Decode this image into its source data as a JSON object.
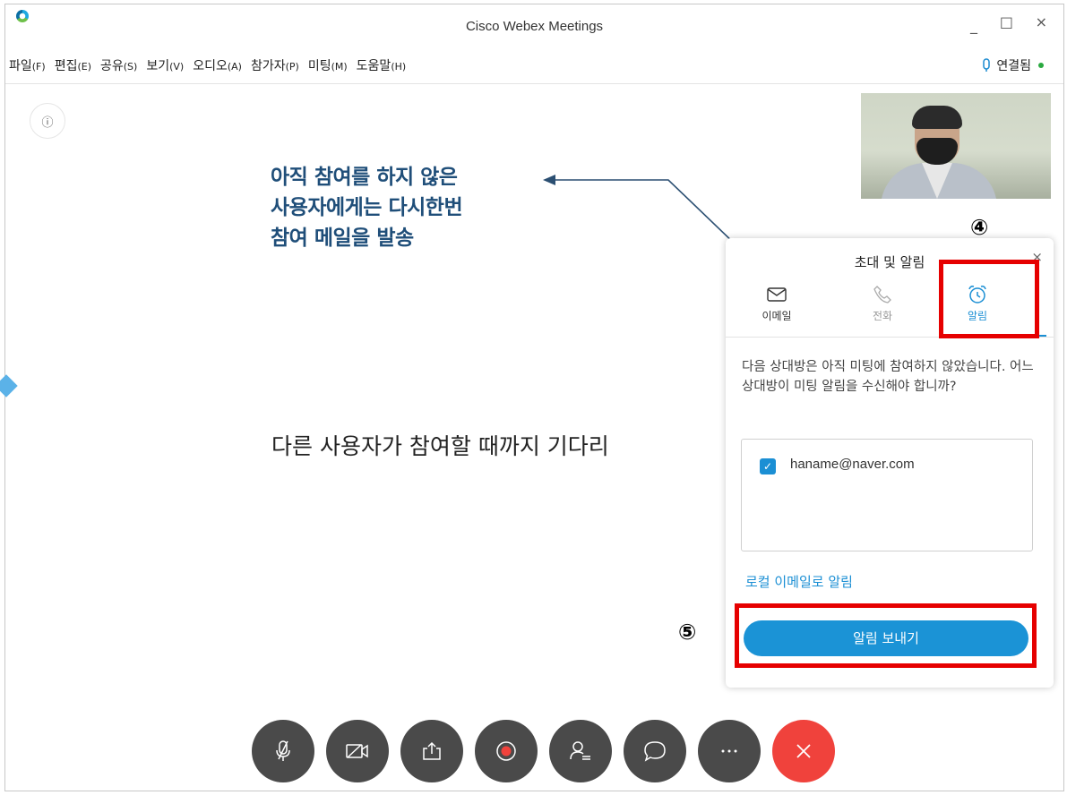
{
  "window": {
    "title": "Cisco Webex Meetings"
  },
  "window_controls": {
    "minimize": "_",
    "maximize": "□",
    "close": "×"
  },
  "menu": [
    {
      "label": "파일",
      "accel": "(F)"
    },
    {
      "label": "편집",
      "accel": "(E)"
    },
    {
      "label": "공유",
      "accel": "(S)"
    },
    {
      "label": "보기",
      "accel": "(V)"
    },
    {
      "label": "오디오",
      "accel": "(A)"
    },
    {
      "label": "참가자",
      "accel": "(P)"
    },
    {
      "label": "미팅",
      "accel": "(M)"
    },
    {
      "label": "도움말",
      "accel": "(H)"
    }
  ],
  "status": {
    "connection": "연결됨",
    "dot_color": "#2aa940"
  },
  "info_icon": "ⓘ",
  "annotation": {
    "text": "아직 참여를 하지 않은\n사용자에게는 다시한번\n참여 메일을 발송",
    "color": "#1f4e79"
  },
  "waiting_text": "다른 사용자가 참여할 때까지 기다리",
  "popup": {
    "title": "초대 및 알림",
    "close": "×",
    "tabs": [
      {
        "label": "이메일",
        "icon": "mail-icon"
      },
      {
        "label": "전화",
        "icon": "phone-icon"
      },
      {
        "label": "알림",
        "icon": "alarm-clock-icon",
        "active": true
      }
    ],
    "description": "다음 상대방은 아직 미팅에 참여하지 않았습니다. 어느 상대방이 미팅 알림을 수신해야 합니까?",
    "invitee": {
      "email": "haname@naver.com",
      "checked": true
    },
    "local_email_link": "로컬 이메일로 알림",
    "send_button": "알림 보내기"
  },
  "steps": {
    "four": "④",
    "five": "⑤"
  },
  "accent_color": "#1b8fd4",
  "controls": [
    {
      "name": "mute-button",
      "icon": "mic-off-icon"
    },
    {
      "name": "video-button",
      "icon": "video-off-icon"
    },
    {
      "name": "share-button",
      "icon": "share-icon"
    },
    {
      "name": "record-button",
      "icon": "record-icon"
    },
    {
      "name": "participants-button",
      "icon": "participants-icon"
    },
    {
      "name": "chat-button",
      "icon": "chat-icon"
    },
    {
      "name": "more-button",
      "icon": "more-icon"
    },
    {
      "name": "end-meeting-button",
      "icon": "close-icon",
      "color": "#f0423c"
    }
  ]
}
